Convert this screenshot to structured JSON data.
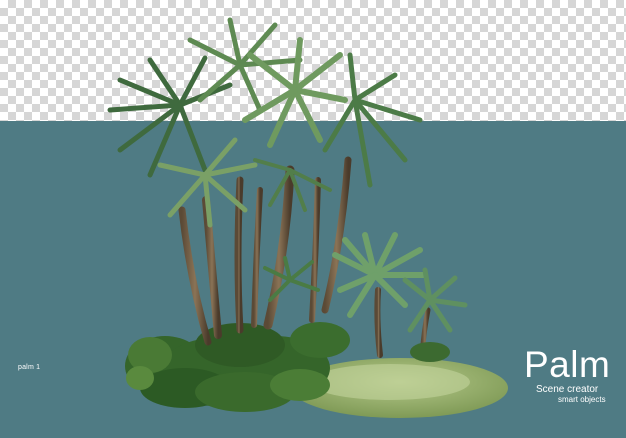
{
  "image": {
    "small_label": "palm 1",
    "brand": {
      "title": "Palm",
      "subtitle": "Scene creator",
      "tagline": "smart objects"
    },
    "colors": {
      "background_teal": "#4f7b84",
      "checker_light": "#ffffff",
      "checker_dark": "#d6d6d6",
      "text": "#ffffff"
    }
  }
}
